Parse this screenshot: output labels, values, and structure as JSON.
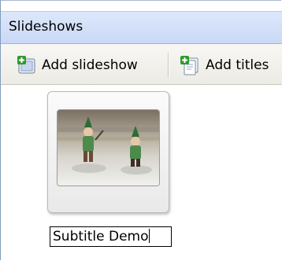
{
  "panel": {
    "title": "Slideshows"
  },
  "toolbar": {
    "add_slideshow_label": "Add slideshow",
    "add_titles_label": "Add titles"
  },
  "slideshows": [
    {
      "name": "Subtitle Demo",
      "editing": true
    }
  ],
  "icons": {
    "add_slideshow": "add-slideshow-icon",
    "add_titles": "add-titles-icon"
  },
  "colors": {
    "header_bg": "#c9d8f5",
    "toolbar_bg": "#ecebe5",
    "add_green": "#2e9a2e"
  }
}
